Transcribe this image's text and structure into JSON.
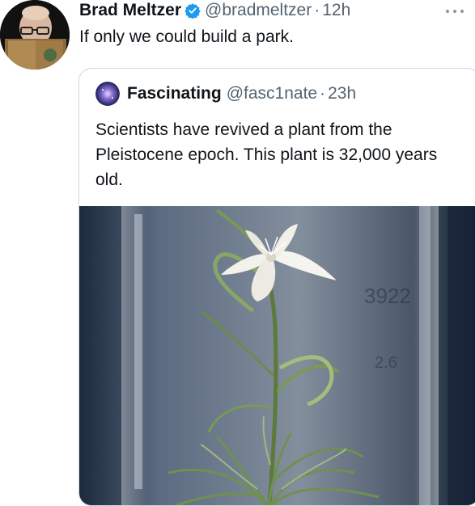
{
  "tweet": {
    "author_name": "Brad Meltzer",
    "author_handle": "@bradmeltzer",
    "separator": "·",
    "time": "12h",
    "text": "If only we could build a park.",
    "verified": true
  },
  "quoted_tweet": {
    "author_name": "Fascinating",
    "author_handle": "@fasc1nate",
    "separator": "·",
    "time": "23h",
    "text": "Scientists have revived a plant from the Pleistocene epoch. This plant is 32,000 years old.",
    "jar_markings": [
      "3922",
      "2.6"
    ]
  },
  "icons": {
    "verified": "verified-badge-icon",
    "more": "more-options-icon"
  },
  "colors": {
    "verified_blue": "#1d9bf0",
    "secondary_text": "#536471",
    "border": "#cfd9de"
  }
}
